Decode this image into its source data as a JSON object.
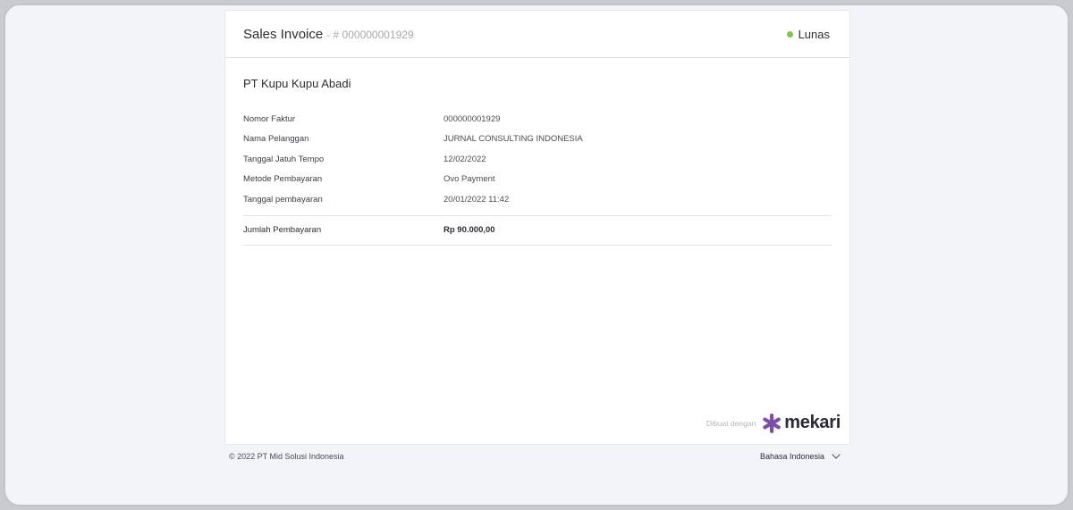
{
  "header": {
    "title": "Sales Invoice",
    "invoice_number": "- # 000000001929",
    "status": "Lunas"
  },
  "company": "PT Kupu Kupu Abadi",
  "details": [
    {
      "label": "Nomor Faktur",
      "value": "000000001929"
    },
    {
      "label": "Nama Pelanggan",
      "value": "JURNAL CONSULTING INDONESIA"
    },
    {
      "label": "Tanggal Jatuh Tempo",
      "value": "12/02/2022"
    },
    {
      "label": "Metode Pembayaran",
      "value": "Ovo Payment"
    },
    {
      "label": "Tanggal pembayaran",
      "value": "20/01/2022 11:42"
    }
  ],
  "total": {
    "label": "Jumlah Pembayaran",
    "value": "Rp 90.000,00"
  },
  "branding": {
    "made_with": "Dibuat dengan",
    "logo_text": "mekari",
    "logo_icon": "mekari-star-icon",
    "logo_color": "#7b4fa8"
  },
  "footer": {
    "copyright": "© 2022 PT Mid Solusi Indonesia",
    "language": "Bahasa Indonesia"
  },
  "colors": {
    "status_green": "#7ac943",
    "page_bg": "#f3f4f8",
    "card_bg": "#ffffff"
  }
}
